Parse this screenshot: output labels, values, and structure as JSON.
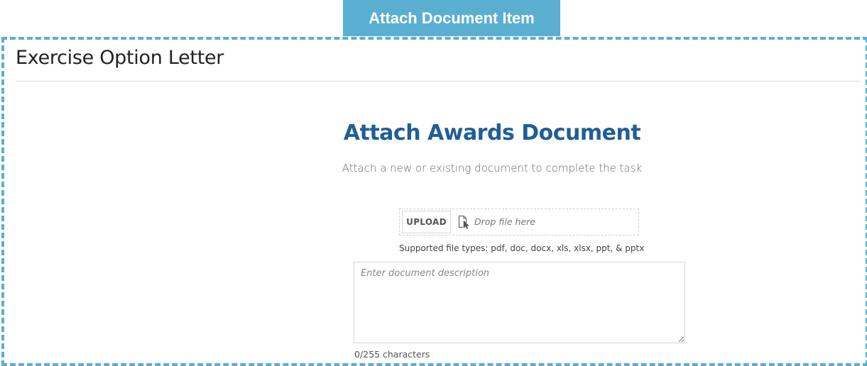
{
  "banner": {
    "label": "Attach Document Item",
    "color": "#5aafd0"
  },
  "page": {
    "title": "Exercise Option Letter"
  },
  "attach": {
    "heading": "Attach Awards Document",
    "heading_color": "#1f5f96",
    "subtitle": "Attach a new or existing document to complete the task",
    "upload_label": "UPLOAD",
    "drop_icon": "file-drop-cursor-icon",
    "drop_text": "Drop file here",
    "supported_types": "Supported file types: pdf, doc, docx, xls, xlsx, ppt, & pptx"
  },
  "description": {
    "value": "",
    "placeholder": "Enter document description",
    "char_count": "0/255 characters"
  }
}
